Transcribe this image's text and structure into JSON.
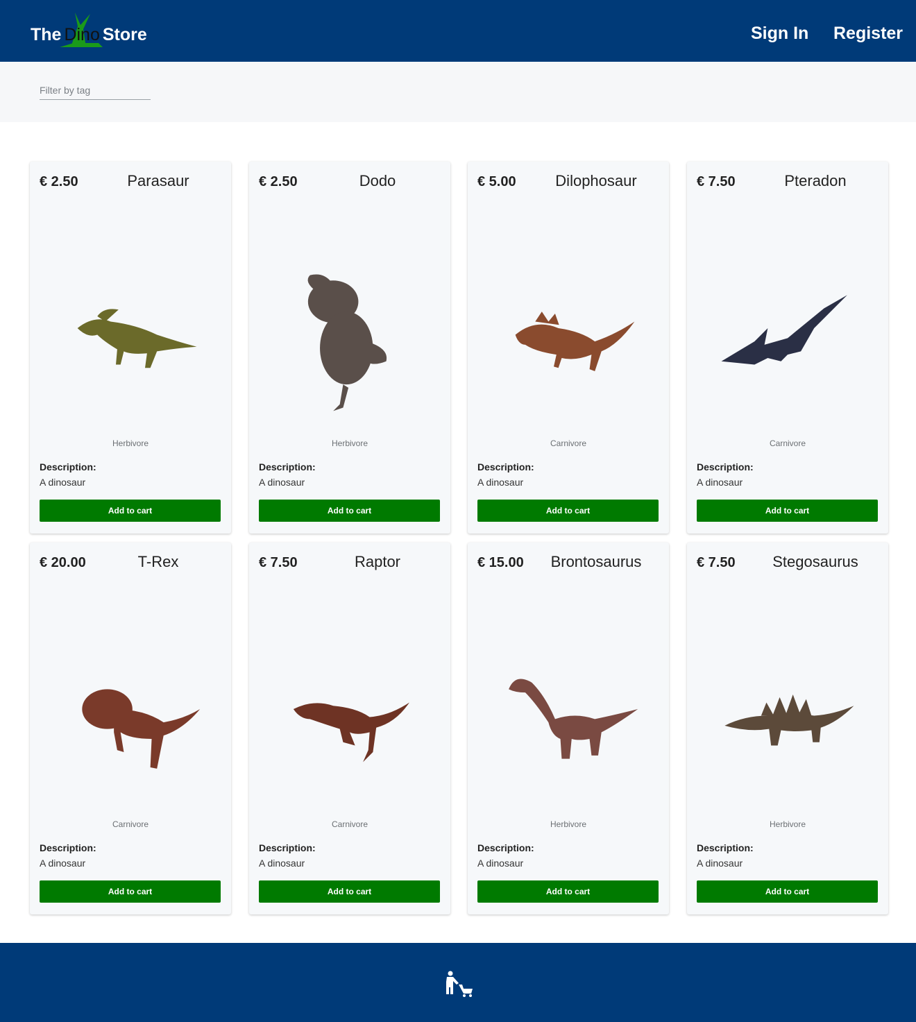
{
  "header": {
    "logo": {
      "prefix": "The",
      "middle": "Dino",
      "suffix": "Store"
    },
    "nav": {
      "sign_in": "Sign In",
      "register": "Register"
    }
  },
  "filter": {
    "placeholder": "Filter by tag",
    "value": ""
  },
  "colors": {
    "header_bg": "#003a78",
    "button_bg": "#007a00",
    "card_bg": "#f6f8fa"
  },
  "products": [
    {
      "price": "€ 2.50",
      "name": "Parasaur",
      "tag": "Herbivore",
      "description_label": "Description:",
      "description": "A dinosaur",
      "button": "Add to cart",
      "image_icon": "parasaur-image",
      "body_color": "#6b6a2a"
    },
    {
      "price": "€ 2.50",
      "name": "Dodo",
      "tag": "Herbivore",
      "description_label": "Description:",
      "description": "A dinosaur",
      "button": "Add to cart",
      "image_icon": "dodo-image",
      "body_color": "#5a4f4a"
    },
    {
      "price": "€ 5.00",
      "name": "Dilophosaur",
      "tag": "Carnivore",
      "description_label": "Description:",
      "description": "A dinosaur",
      "button": "Add to cart",
      "image_icon": "dilophosaur-image",
      "body_color": "#8a4b2e"
    },
    {
      "price": "€ 7.50",
      "name": "Pteradon",
      "tag": "Carnivore",
      "description_label": "Description:",
      "description": "A dinosaur",
      "button": "Add to cart",
      "image_icon": "pteradon-image",
      "body_color": "#2a2f45"
    },
    {
      "price": "€ 20.00",
      "name": "T-Rex",
      "tag": "Carnivore",
      "description_label": "Description:",
      "description": "A dinosaur",
      "button": "Add to cart",
      "image_icon": "t-rex-image",
      "body_color": "#7a3a2a"
    },
    {
      "price": "€ 7.50",
      "name": "Raptor",
      "tag": "Carnivore",
      "description_label": "Description:",
      "description": "A dinosaur",
      "button": "Add to cart",
      "image_icon": "raptor-image",
      "body_color": "#6e3324"
    },
    {
      "price": "€ 15.00",
      "name": "Brontosaurus",
      "tag": "Herbivore",
      "description_label": "Description:",
      "description": "A dinosaur",
      "button": "Add to cart",
      "image_icon": "brontosaurus-image",
      "body_color": "#7a4a42"
    },
    {
      "price": "€ 7.50",
      "name": "Stegosaurus",
      "tag": "Herbivore",
      "description_label": "Description:",
      "description": "A dinosaur",
      "button": "Add to cart",
      "image_icon": "stegosaurus-image",
      "body_color": "#5c4a3a"
    }
  ],
  "footer": {
    "icon": "shopping-cart-person-icon"
  }
}
